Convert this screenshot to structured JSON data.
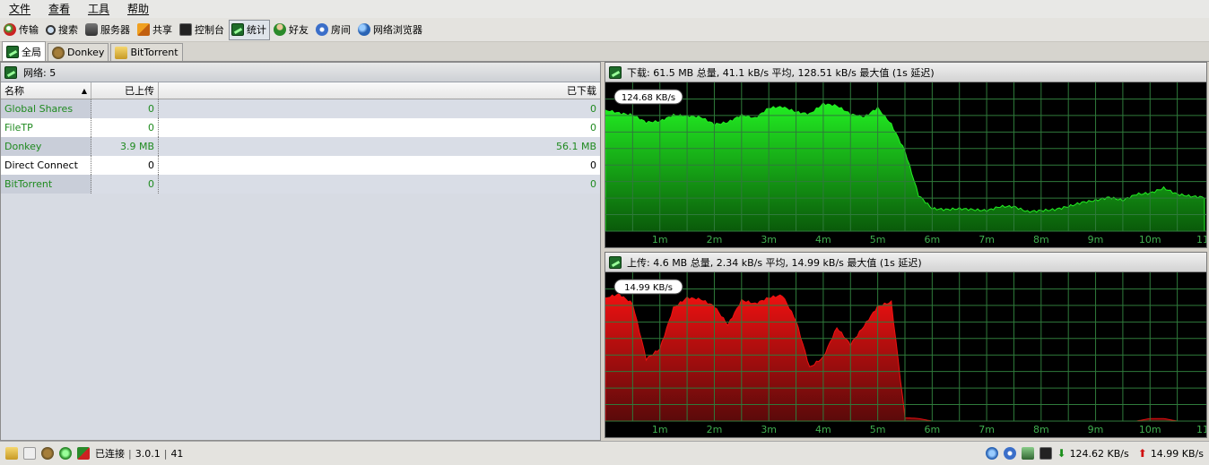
{
  "menubar": {
    "items": [
      {
        "label": "文件"
      },
      {
        "label": "查看"
      },
      {
        "label": "工具"
      },
      {
        "label": "帮助"
      }
    ]
  },
  "toolbar": {
    "items": [
      {
        "label": "传输",
        "icon": "transfer-icon"
      },
      {
        "label": "搜索",
        "icon": "search-icon"
      },
      {
        "label": "服务器",
        "icon": "server-icon"
      },
      {
        "label": "共享",
        "icon": "share-icon"
      },
      {
        "label": "控制台",
        "icon": "console-icon"
      },
      {
        "label": "统计",
        "icon": "statistics-icon",
        "active": true
      },
      {
        "label": "好友",
        "icon": "friends-icon"
      },
      {
        "label": "房间",
        "icon": "rooms-icon"
      },
      {
        "label": "网络浏览器",
        "icon": "browser-icon"
      }
    ]
  },
  "tabs": [
    {
      "label": "全局",
      "icon": "statistics-icon",
      "active": true
    },
    {
      "label": "Donkey",
      "icon": "donkey-icon"
    },
    {
      "label": "BitTorrent",
      "icon": "bittorrent-icon"
    }
  ],
  "network_panel": {
    "title": "网络: 5",
    "columns": [
      "名称",
      "已上传",
      "已下载"
    ],
    "rows": [
      {
        "name": "Global Shares",
        "uploaded": "0",
        "downloaded": "0",
        "color": "#1f8a1f"
      },
      {
        "name": "FileTP",
        "uploaded": "0",
        "downloaded": "0",
        "color": "#1f8a1f"
      },
      {
        "name": "Donkey",
        "uploaded": "3.9 MB",
        "downloaded": "56.1 MB",
        "color": "#1f8a1f"
      },
      {
        "name": "Direct Connect",
        "uploaded": "0",
        "downloaded": "0",
        "color": "#000000"
      },
      {
        "name": "BitTorrent",
        "uploaded": "0",
        "downloaded": "0",
        "color": "#1f8a1f"
      }
    ]
  },
  "download_graph": {
    "title": "下载: 61.5 MB 总量, 41.1 kB/s 平均, 128.51 kB/s 最大值 (1s 延迟)",
    "peak_label": "124.68 KB/s",
    "color": "#22dd22"
  },
  "upload_graph": {
    "title": "上传: 4.6 MB 总量, 2.34 kB/s 平均, 14.99 kB/s 最大值 (1s 延迟)",
    "peak_label": "14.99 KB/s",
    "color": "#dd1111"
  },
  "chart_data": [
    {
      "type": "area",
      "title": "下载: 61.5 MB 总量, 41.1 kB/s 平均, 128.51 kB/s 最大值 (1s 延迟)",
      "xlabel": "",
      "ylabel": "",
      "x_ticks": [
        "1m",
        "2m",
        "3m",
        "4m",
        "5m",
        "6m",
        "7m",
        "8m",
        "9m",
        "10m",
        "11"
      ],
      "x": [
        0,
        0.25,
        0.5,
        0.75,
        1,
        1.25,
        1.5,
        1.75,
        2,
        2.25,
        2.5,
        2.75,
        3,
        3.25,
        3.5,
        3.75,
        4,
        4.25,
        4.5,
        4.75,
        5,
        5.25,
        5.5,
        5.75,
        6,
        6.25,
        6.5,
        6.75,
        7,
        7.25,
        7.5,
        7.75,
        8,
        8.25,
        8.5,
        8.75,
        9,
        9.25,
        9.5,
        9.75,
        10,
        10.25,
        10.5,
        10.75,
        11
      ],
      "series": [
        {
          "values": [
            118,
            115,
            113,
            106,
            107,
            113,
            112,
            111,
            104,
            106,
            113,
            110,
            120,
            121,
            116,
            114,
            124,
            122,
            114,
            111,
            120,
            104,
            78,
            35,
            22,
            21,
            22,
            21,
            20,
            24,
            24,
            19,
            20,
            21,
            24,
            28,
            30,
            33,
            30,
            36,
            37,
            42,
            36,
            34,
            33
          ]
        }
      ],
      "ylim": [
        0,
        145
      ],
      "grid": true
    },
    {
      "type": "area",
      "title": "上传: 4.6 MB 总量, 2.34 kB/s 平均, 14.99 kB/s 最大值 (1s 延迟)",
      "xlabel": "",
      "ylabel": "",
      "x_ticks": [
        "1m",
        "2m",
        "3m",
        "4m",
        "5m",
        "6m",
        "7m",
        "8m",
        "9m",
        "10m",
        "11"
      ],
      "x": [
        0,
        0.25,
        0.5,
        0.75,
        1,
        1.25,
        1.5,
        1.75,
        2,
        2.25,
        2.5,
        2.75,
        3,
        3.25,
        3.5,
        3.75,
        4,
        4.25,
        4.5,
        4.75,
        5,
        5.25,
        5.5,
        5.75,
        6,
        6.25,
        6.5,
        6.75,
        7,
        7.25,
        7.5,
        7.75,
        8,
        8.25,
        8.5,
        8.75,
        9,
        9.25,
        9.5,
        9.75,
        10,
        10.25,
        10.5,
        10.75,
        11
      ],
      "series": [
        {
          "values": [
            14.5,
            14.9,
            13.8,
            7.3,
            8.5,
            13.3,
            14.5,
            14.3,
            13.5,
            11.3,
            14.2,
            13.8,
            14.5,
            14.8,
            11.8,
            6.3,
            7.5,
            11.0,
            9.0,
            11.2,
            13.5,
            14.0,
            0.4,
            0.3,
            0.0,
            0.0,
            0.0,
            0.0,
            0.0,
            0.0,
            0.0,
            0.0,
            0.0,
            0.0,
            0.0,
            0.0,
            0.0,
            0.0,
            0.0,
            0.0,
            0.3,
            0.3,
            0.0,
            0.0,
            0.0
          ]
        }
      ],
      "ylim": [
        0,
        17.5
      ],
      "grid": true
    }
  ],
  "statusbar": {
    "status": "已连接",
    "version": "3.0.1",
    "count": "41",
    "download_rate": "124.62 KB/s",
    "upload_rate": "14.99 KB/s"
  }
}
